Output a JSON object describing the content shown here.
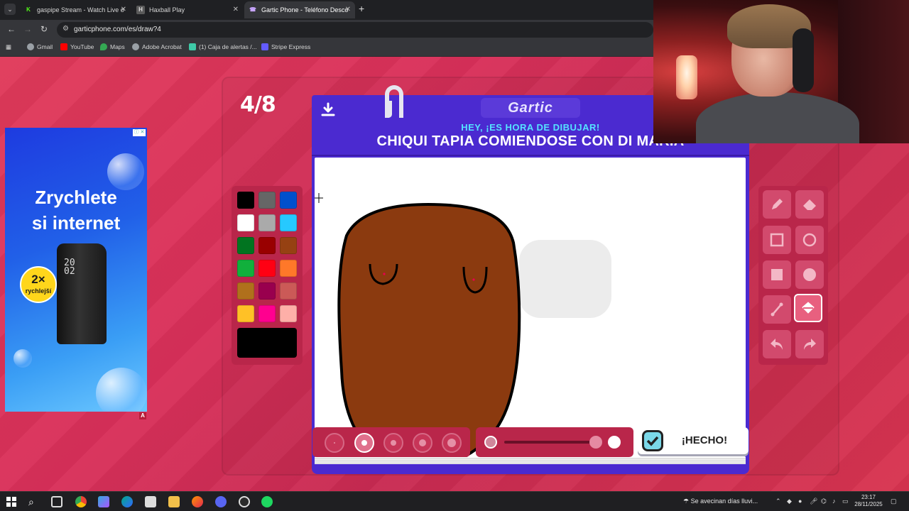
{
  "browser": {
    "tabs": [
      {
        "title": "gaspipe Stream - Watch Live o",
        "favicon": "kick-icon",
        "color": "#53fc18"
      },
      {
        "title": "Haxball Play",
        "favicon": "haxball-icon",
        "color": "#9a9a9a"
      },
      {
        "title": "Gartic Phone - Teléfono Desco",
        "favicon": "gartic-icon",
        "color": "#a66bff"
      }
    ],
    "url": "garticphone.com/es/draw?4",
    "bookmarks": [
      {
        "label": "Gmail",
        "color": "#9aa0a6"
      },
      {
        "label": "YouTube",
        "color": "#ff0000"
      },
      {
        "label": "Maps",
        "color": "#34a853"
      },
      {
        "label": "Adobe Acrobat",
        "color": "#9aa0a6"
      },
      {
        "label": "(1) Caja de alertas /...",
        "color": "#3ec9a7"
      },
      {
        "label": "Stripe Express",
        "color": "#635bff"
      }
    ]
  },
  "game": {
    "round": "4/8",
    "logo": "Gartic",
    "subtitle": "HEY, ¡ES HORA DE DIBUJAR!",
    "prompt": "CHIQUI TAPIA COMIENDOSE CON DI MARÍA",
    "done_label": "¡HECHO!",
    "palette": [
      "#000000",
      "#666666",
      "#0050cd",
      "#ffffff",
      "#aaaaaa",
      "#26c9ff",
      "#017420",
      "#990000",
      "#964112",
      "#11b03c",
      "#ff0013",
      "#ff7829",
      "#b0701c",
      "#99004e",
      "#cb5a57",
      "#ffc126",
      "#ff008f",
      "#feafa8"
    ],
    "current_color": "#000000",
    "drawing_fill": "#8b3a0f",
    "selected_tool": "fill",
    "selected_brush_size": 2,
    "opacity": 1.0
  },
  "ad": {
    "title_line1": "Zrychlete",
    "title_line2": "si internet",
    "badge_big": "2×",
    "badge_small": "rychlejší",
    "device_time_1": "20",
    "device_time_2": "02",
    "adchoice": "A"
  },
  "taskbar": {
    "weather": "Se avecinan días lluvi...",
    "time": "23:17",
    "date": "28/11/2025"
  }
}
